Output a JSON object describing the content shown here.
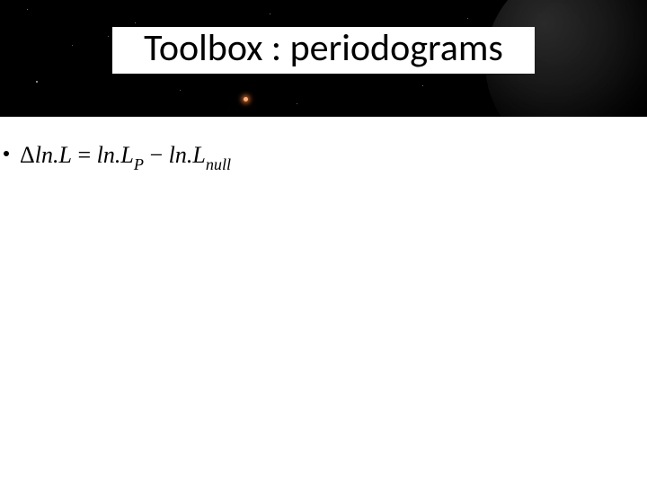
{
  "title": "Toolbox : periodograms",
  "formula": {
    "delta": "Δ",
    "ln": "ln.",
    "L": "L",
    "eq": " = ",
    "sub_P": "P",
    "minus": " − ",
    "sub_null": "null"
  }
}
